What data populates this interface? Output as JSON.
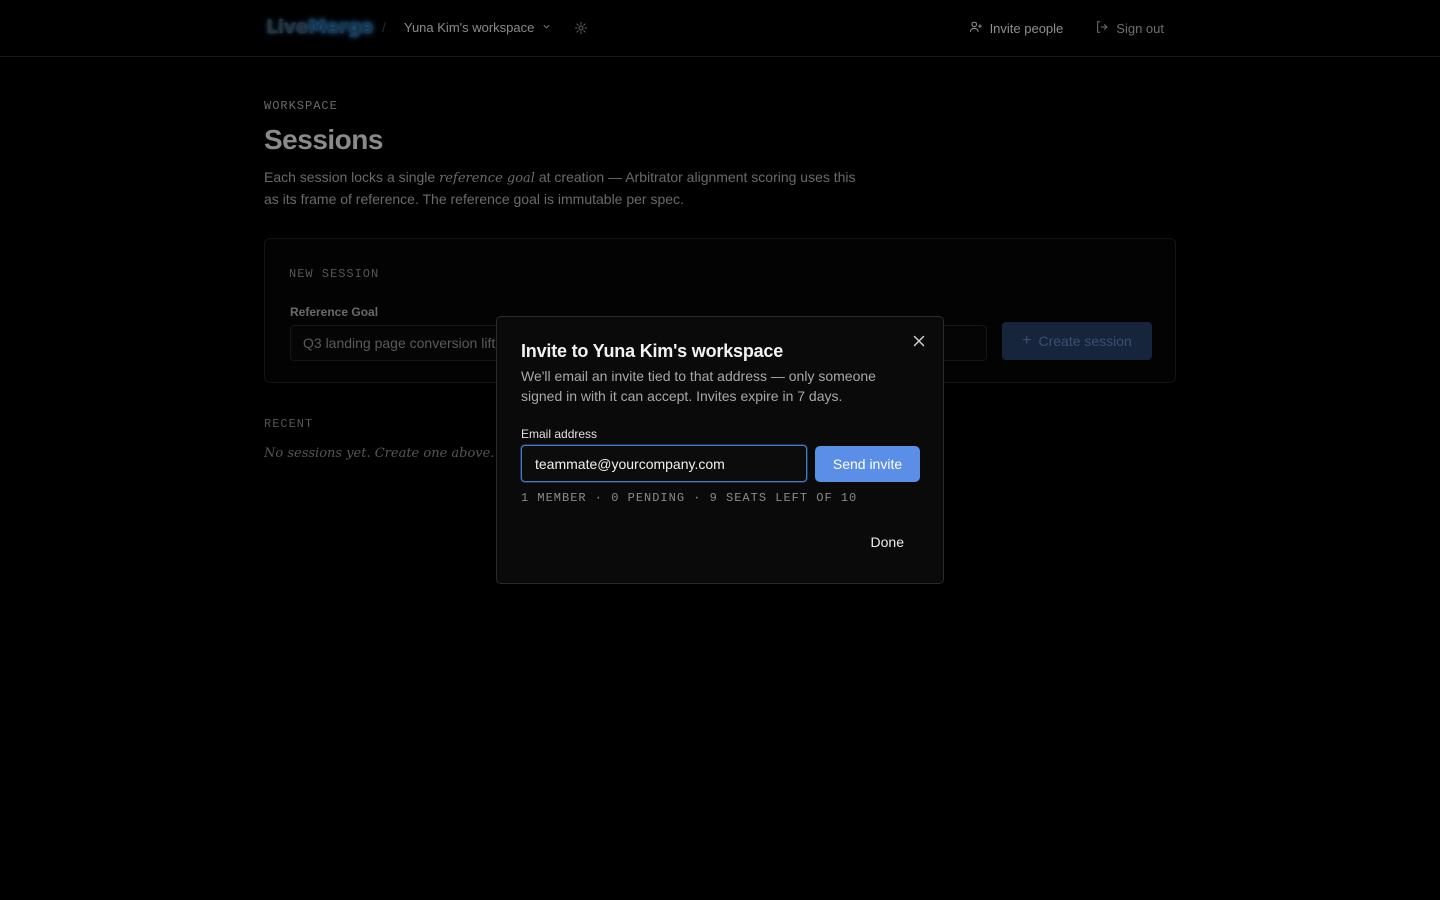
{
  "app": {
    "logo_part1": "Live",
    "logo_part2": "Merge",
    "crumb_separator": "/"
  },
  "topbar": {
    "workspace_name": "Yuna Kim's workspace",
    "invite_label": "Invite people",
    "signout_label": "Sign out",
    "icons": [
      "gear-icon",
      "user-plus-icon",
      "sign-out-icon",
      "chevron-down-icon"
    ]
  },
  "page": {
    "eyebrow": "WORKSPACE",
    "title": "Sessions",
    "desc_before": "Each session locks a single ",
    "desc_emphasis": "reference goal",
    "desc_after": " at creation — Arbitrator alignment scoring uses this as its frame of reference. The reference goal is immutable per spec."
  },
  "new_session": {
    "section_label": "NEW SESSION",
    "field_label": "Reference Goal",
    "goal_value": "Q3 landing page conversion lift",
    "create_label": "Create session"
  },
  "recent": {
    "section_label": "RECENT",
    "empty_text": "No sessions yet. Create one above."
  },
  "modal": {
    "title": "Invite to Yuna Kim's workspace",
    "description": "We'll email an invite tied to that address — only someone signed in with it can accept. Invites expire in 7 days.",
    "email_label": "Email address",
    "email_value": "teammate@yourcompany.com",
    "send_label": "Send invite",
    "stats": "1 MEMBER · 0 PENDING · 9 SEATS LEFT OF 10",
    "done_label": "Done"
  }
}
